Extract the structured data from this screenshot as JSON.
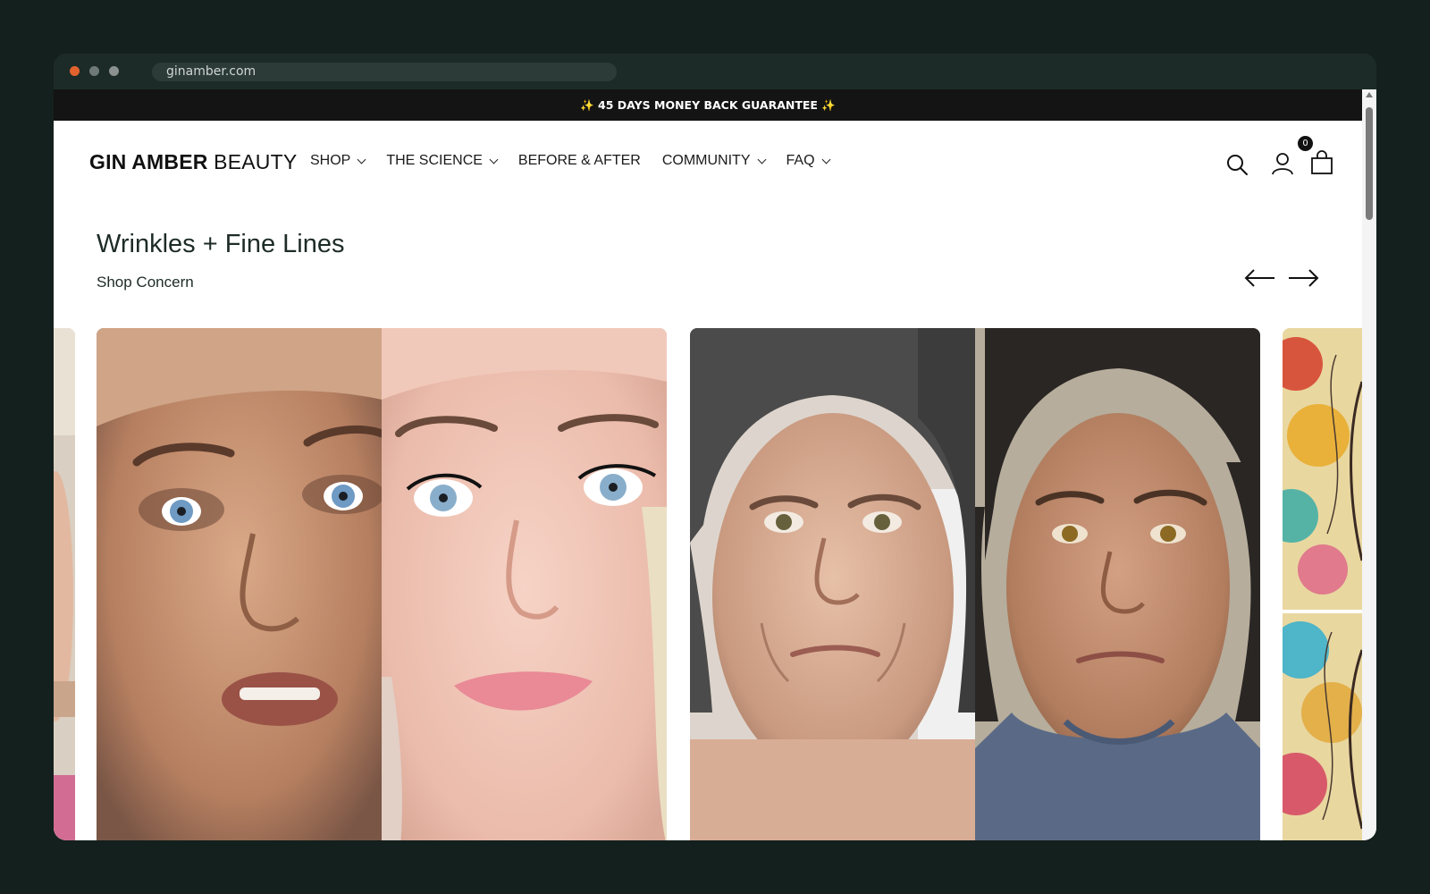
{
  "browser": {
    "url": "ginamber.com"
  },
  "announcement": {
    "text": "✨ 45 DAYS MONEY BACK GUARANTEE ✨"
  },
  "header": {
    "logo_bold": "GIN AMBER",
    "logo_light": " BEAUTY",
    "nav": [
      {
        "label": "SHOP",
        "has_dropdown": true
      },
      {
        "label": "THE SCIENCE",
        "has_dropdown": true
      },
      {
        "label": "BEFORE & AFTER",
        "has_dropdown": false
      },
      {
        "label": "COMMUNITY",
        "has_dropdown": true
      },
      {
        "label": "FAQ",
        "has_dropdown": true
      }
    ],
    "icons": [
      "search-icon",
      "account-icon",
      "cart-icon"
    ],
    "cart_count": "0"
  },
  "section": {
    "title": "Wrinkles + Fine Lines",
    "subtitle": "Shop Concern"
  },
  "carousel": {
    "cards": [
      {
        "kind": "before-after-photo",
        "subject": "young woman with blue eyes"
      },
      {
        "kind": "before-after-photo",
        "subject": "middle-aged woman, towel on head / grey t-shirt"
      }
    ]
  },
  "colors": {
    "page_bg": "#14201d",
    "chrome_bg": "#1c2b27",
    "announcement_bg": "#141414",
    "heading": "#1d2b27",
    "close_dot": "#e2622e"
  }
}
